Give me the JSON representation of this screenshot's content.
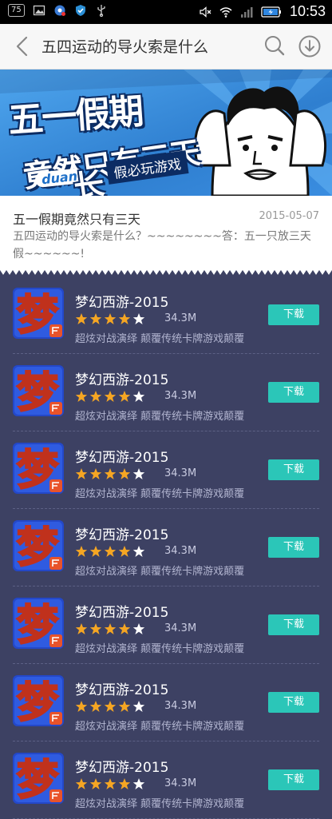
{
  "statusbar": {
    "badge": "75",
    "clock": "10:53",
    "battery_icon": "battery-charging-icon",
    "wifi_icon": "wifi-icon"
  },
  "appbar": {
    "title": "五四运动的导火索是什么"
  },
  "banner": {
    "line1": "五一假期",
    "line2": "竟然只有三天",
    "logo": "duan",
    "tag": "假必玩游戏",
    "mark": "长"
  },
  "card": {
    "title": "五一假期竟然只有三天",
    "date": "2015-05-07",
    "desc": "五四运动的导火索是什么？~~~~~~~~答：五一只放三天假~~~~~~!"
  },
  "colors": {
    "list_bg": "#3d4163",
    "accent": "#2bc6b8",
    "star": "#f5a623"
  },
  "list": [
    {
      "name": "梦幻西游-2015",
      "rating": 4,
      "size": "34.3M",
      "desc": "超炫对战演绎 颠覆传统卡牌游戏颠覆",
      "button": "下载"
    },
    {
      "name": "梦幻西游-2015",
      "rating": 4,
      "size": "34.3M",
      "desc": "超炫对战演绎 颠覆传统卡牌游戏颠覆",
      "button": "下载"
    },
    {
      "name": "梦幻西游-2015",
      "rating": 4,
      "size": "34.3M",
      "desc": "超炫对战演绎 颠覆传统卡牌游戏颠覆",
      "button": "下载"
    },
    {
      "name": "梦幻西游-2015",
      "rating": 4,
      "size": "34.3M",
      "desc": "超炫对战演绎 颠覆传统卡牌游戏颠覆",
      "button": "下载"
    },
    {
      "name": "梦幻西游-2015",
      "rating": 4,
      "size": "34.3M",
      "desc": "超炫对战演绎 颠覆传统卡牌游戏颠覆",
      "button": "下载"
    },
    {
      "name": "梦幻西游-2015",
      "rating": 4,
      "size": "34.3M",
      "desc": "超炫对战演绎 颠覆传统卡牌游戏颠覆",
      "button": "下载"
    },
    {
      "name": "梦幻西游-2015",
      "rating": 4,
      "size": "34.3M",
      "desc": "超炫对战演绎 颠覆传统卡牌游戏颠覆",
      "button": "下载"
    }
  ]
}
